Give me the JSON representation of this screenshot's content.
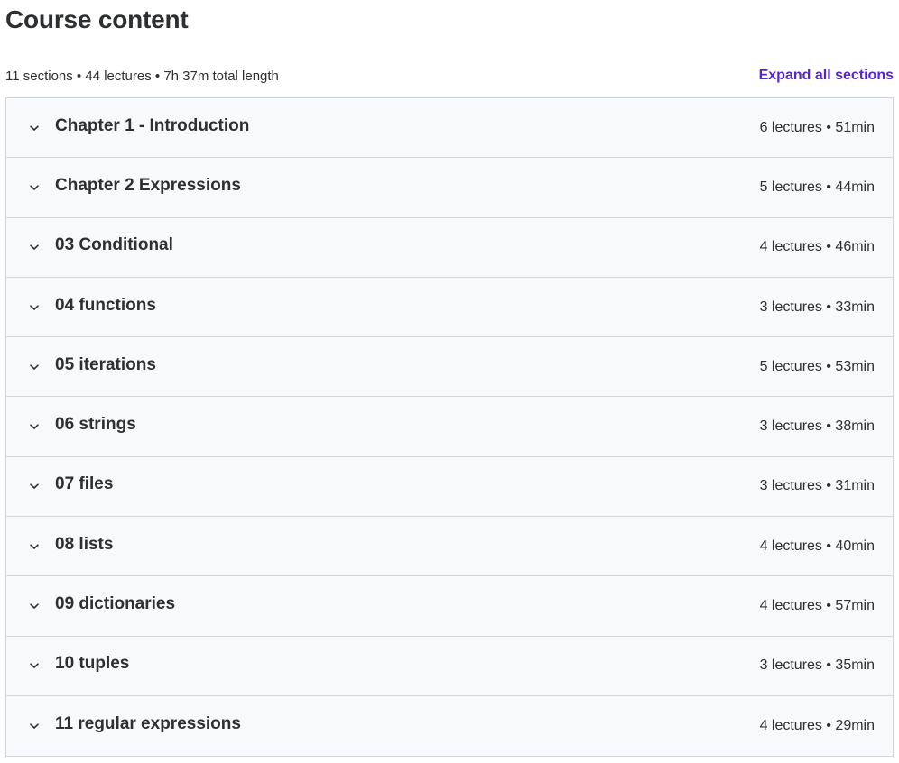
{
  "header": {
    "title": "Course content",
    "summary": "11 sections • 44 lectures • 7h 37m total length",
    "expand_all_label": "Expand all sections"
  },
  "icons": {
    "section_toggle": "chevron-down-icon"
  },
  "colors": {
    "accent": "#5624d0",
    "text": "#2d2f31",
    "section_background": "#f7f9fa",
    "border": "#d1d7dc"
  },
  "sections": [
    {
      "title": "Chapter 1 - Introduction",
      "meta": "6 lectures • 51min"
    },
    {
      "title": "Chapter 2 Expressions",
      "meta": "5 lectures • 44min"
    },
    {
      "title": "03 Conditional",
      "meta": "4 lectures • 46min"
    },
    {
      "title": "04 functions",
      "meta": "3 lectures • 33min"
    },
    {
      "title": "05 iterations",
      "meta": "5 lectures • 53min"
    },
    {
      "title": "06 strings",
      "meta": "3 lectures • 38min"
    },
    {
      "title": "07 files",
      "meta": "3 lectures • 31min"
    },
    {
      "title": "08 lists",
      "meta": "4 lectures • 40min"
    },
    {
      "title": "09 dictionaries",
      "meta": "4 lectures • 57min"
    },
    {
      "title": "10 tuples",
      "meta": "3 lectures • 35min"
    },
    {
      "title": "11 regular expressions",
      "meta": "4 lectures • 29min"
    }
  ]
}
